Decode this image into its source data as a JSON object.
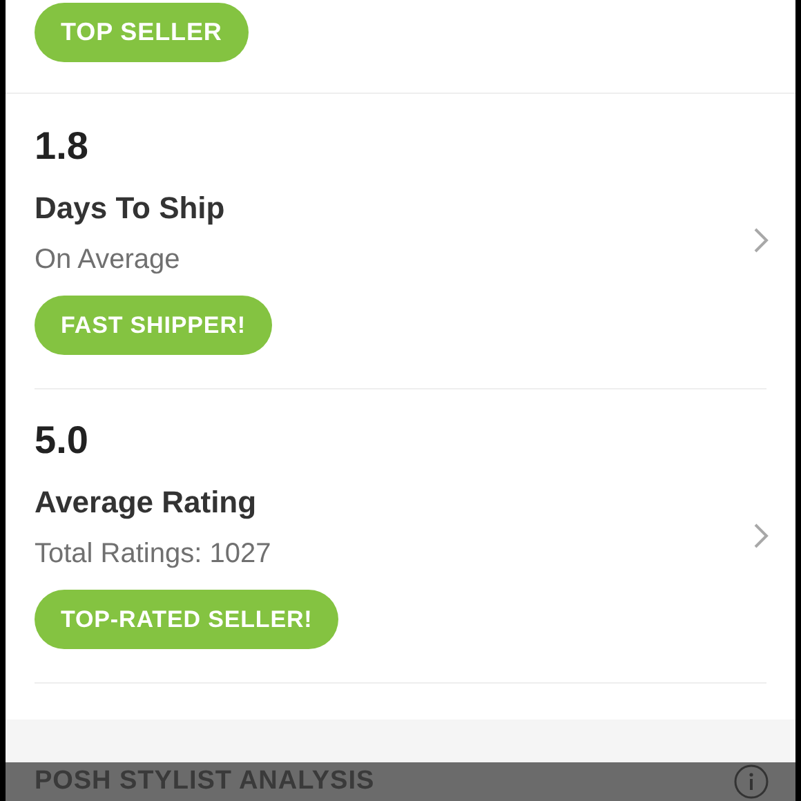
{
  "top_badge": "TOP SELLER",
  "stats": [
    {
      "value": "1.8",
      "label": "Days To Ship",
      "sub": "On Average",
      "badge": "FAST SHIPPER!"
    },
    {
      "value": "5.0",
      "label": "Average Rating",
      "sub": "Total Ratings: 1027",
      "badge": "TOP-RATED SELLER!"
    }
  ],
  "section_header": {
    "title": "POSH STYLIST ANALYSIS"
  }
}
